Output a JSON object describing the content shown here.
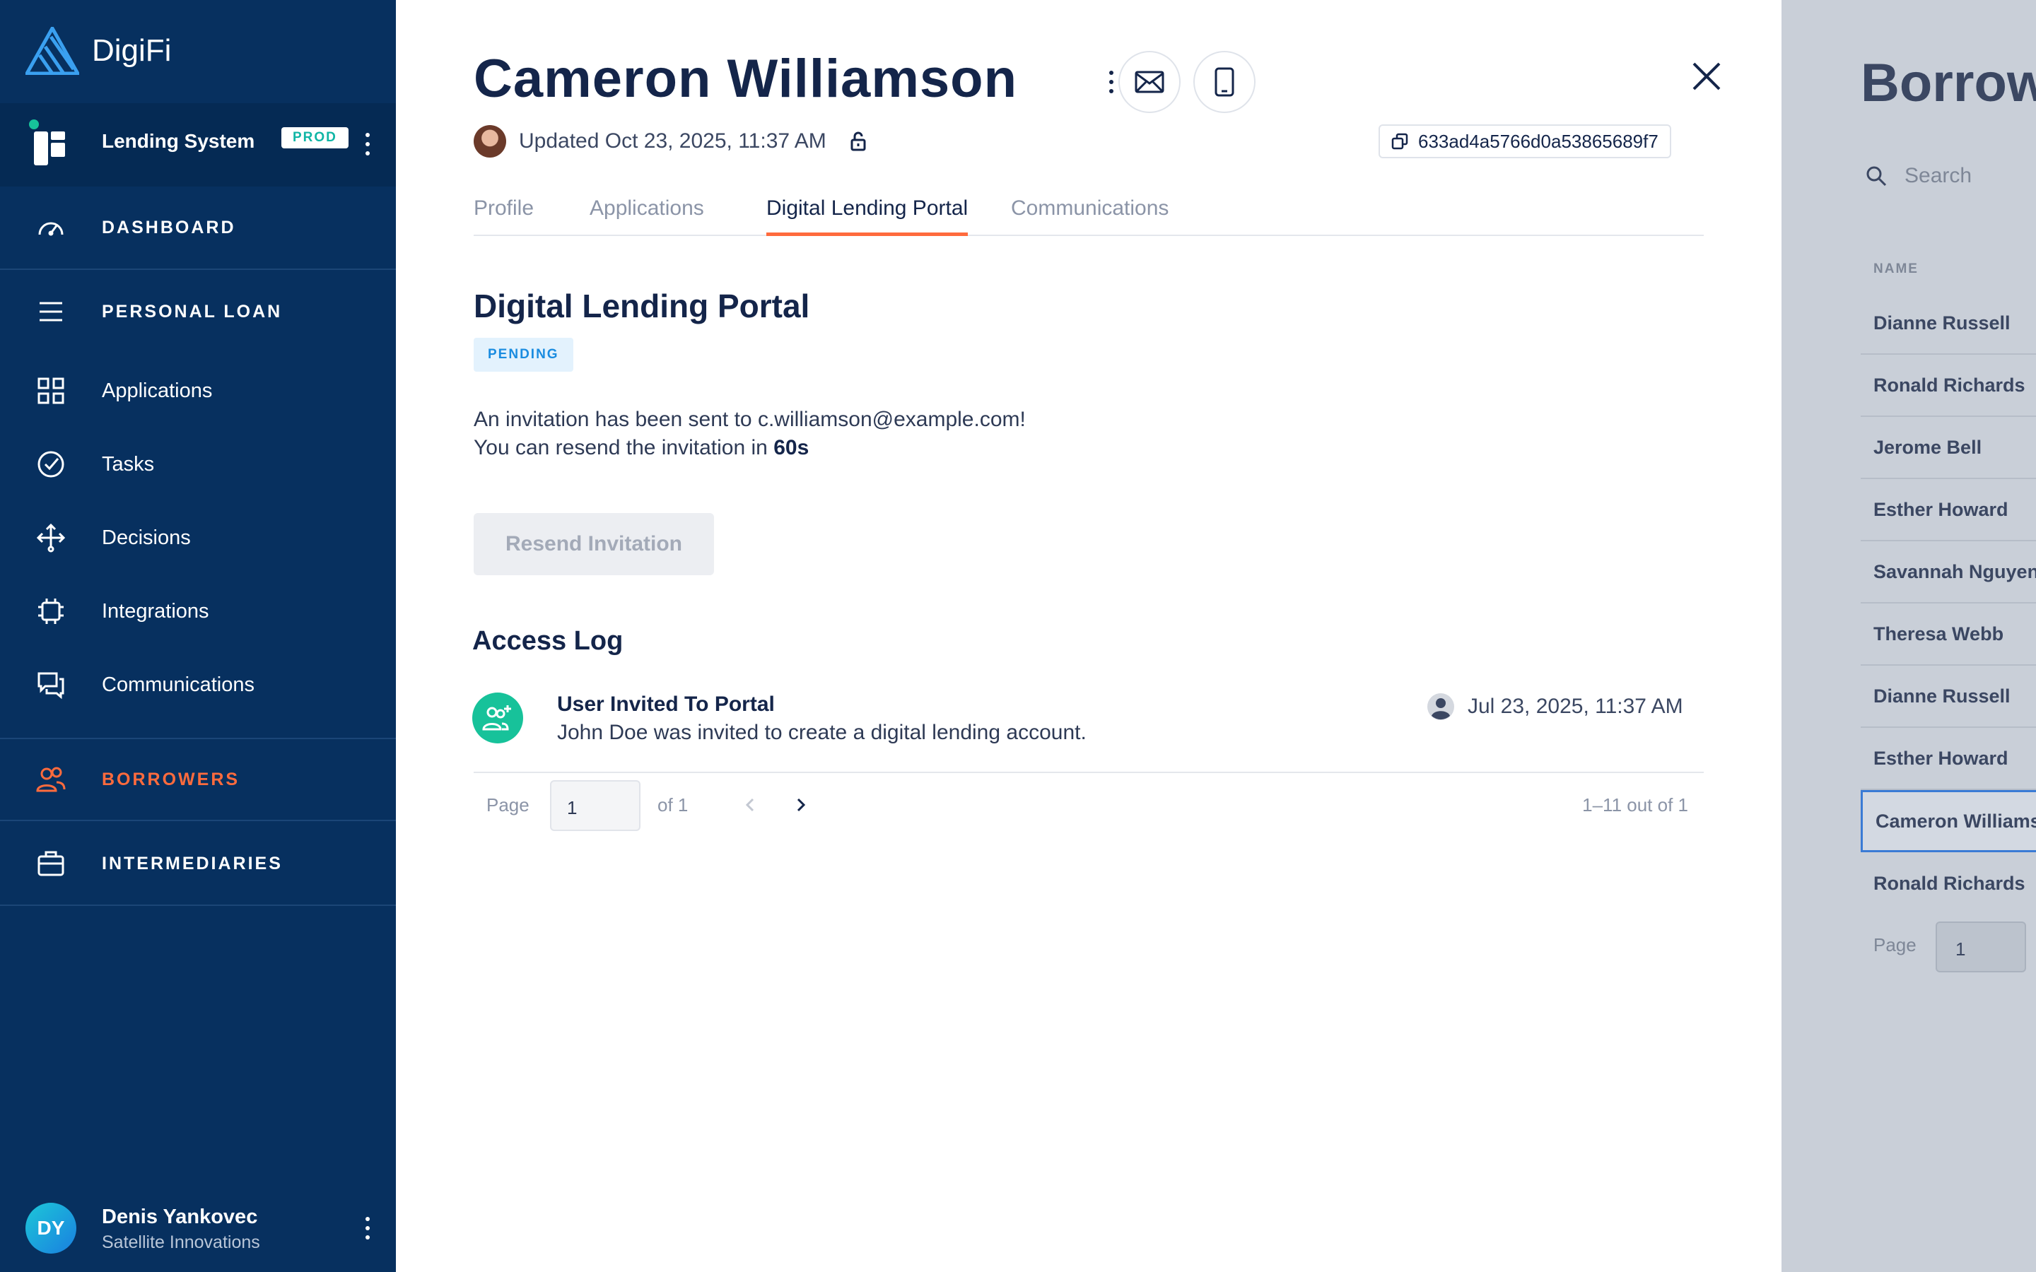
{
  "brand": {
    "name": "DigiFi"
  },
  "system": {
    "name": "Lending System",
    "badge": "PROD"
  },
  "nav": {
    "dashboard": "DASHBOARD",
    "personal_loan": "PERSONAL LOAN",
    "items": [
      {
        "label": "Applications",
        "icon": "grid-icon"
      },
      {
        "label": "Tasks",
        "icon": "check-circle-icon"
      },
      {
        "label": "Decisions",
        "icon": "split-arrows-icon"
      },
      {
        "label": "Integrations",
        "icon": "chip-icon"
      },
      {
        "label": "Communications",
        "icon": "chat-icon"
      }
    ],
    "borrowers": "BORROWERS",
    "intermediaries": "INTERMEDIARIES"
  },
  "user": {
    "initials": "DY",
    "name": "Denis Yankovec",
    "org": "Satellite Innovations"
  },
  "borrower": {
    "name": "Cameron Williamson",
    "updated": "Updated Oct 23, 2025, 11:37 AM",
    "id": "633ad4a5766d0a53865689f7"
  },
  "tabs": [
    "Profile",
    "Applications",
    "Digital Lending Portal",
    "Communications"
  ],
  "portal": {
    "title": "Digital Lending Portal",
    "status": "PENDING",
    "invite_line1": "An invitation has been sent to c.williamson@example.com!",
    "invite_line2_prefix": "You can resend the invitation in ",
    "invite_countdown": "60s",
    "resend_label": "Resend Invitation"
  },
  "access_log": {
    "title": "Access Log",
    "entries": [
      {
        "title": "User Invited To Portal",
        "description": "John Doe was invited to create a digital lending account.",
        "date": "Jul 23, 2025, 11:37 AM"
      }
    ],
    "pager": {
      "page_label": "Page",
      "page_value": "1",
      "of_label": "of 1",
      "count": "1–11 out of 1"
    }
  },
  "background_list": {
    "title": "Borrowers",
    "search_placeholder": "Search",
    "column": "NAME",
    "rows": [
      "Dianne Russell",
      "Ronald Richards",
      "Jerome Bell",
      "Esther Howard",
      "Savannah Nguyen",
      "Theresa Webb",
      "Dianne Russell",
      "Esther Howard",
      "Cameron Williamson",
      "Ronald Richards"
    ],
    "page_label": "Page",
    "page_value": "1"
  },
  "colors": {
    "sidebar": "#07305f",
    "accent": "#ff6b3d",
    "success": "#17c29a",
    "pending_text": "#1a8ce0"
  }
}
